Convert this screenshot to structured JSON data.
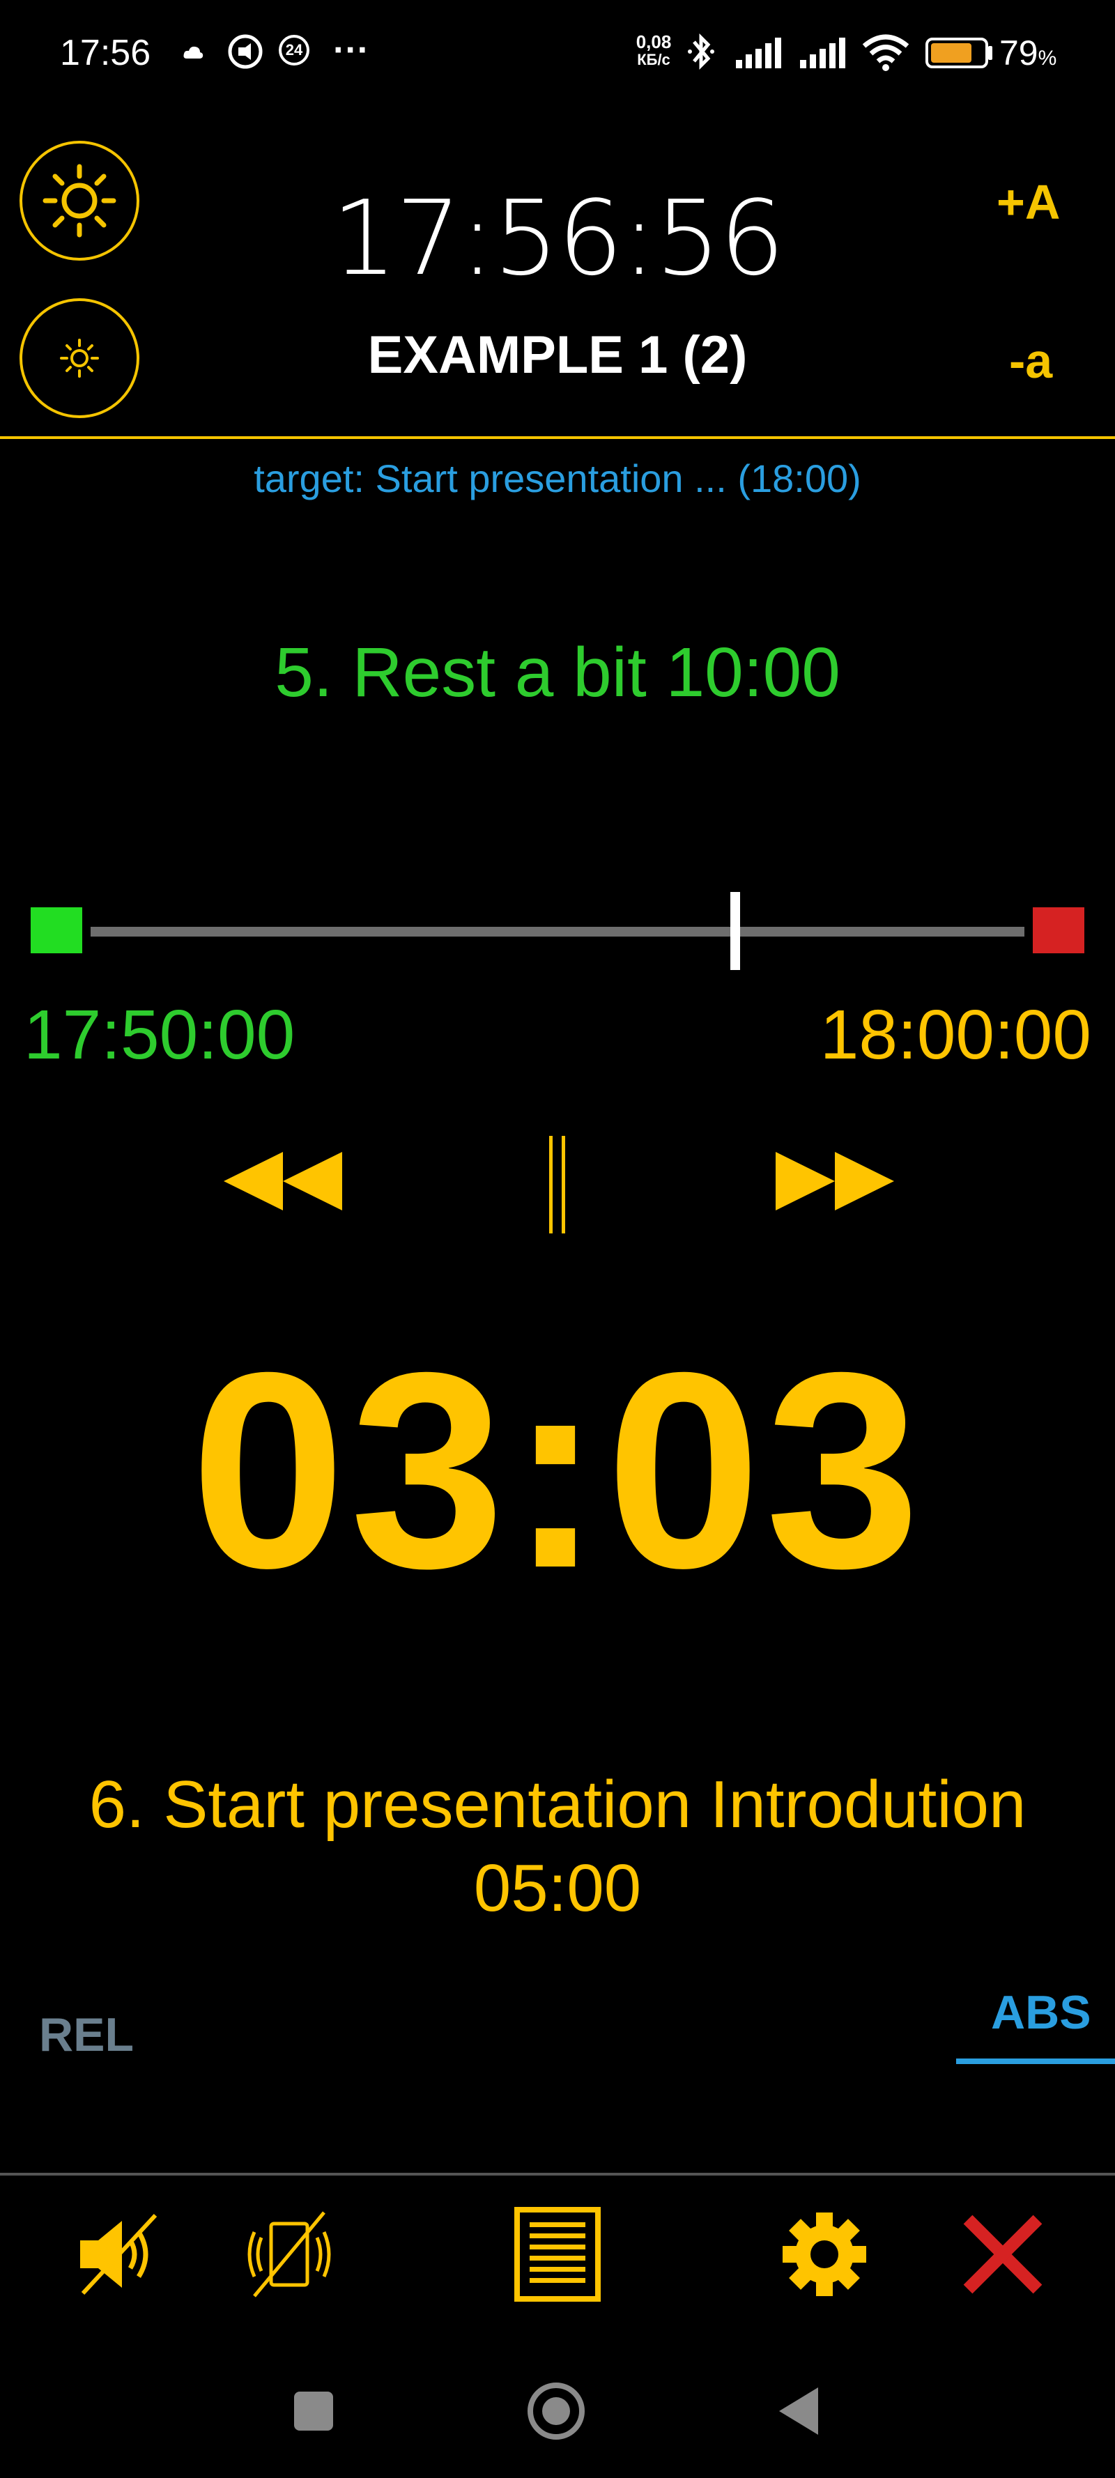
{
  "status_bar": {
    "time": "17:56",
    "notification_badge": "24",
    "more": "···",
    "net_speed_top": "0,08",
    "net_speed_bottom": "КБ/с",
    "battery": "79",
    "battery_unit": "%",
    "icons": [
      "cloud-icon",
      "whatsapp-icon",
      "badge-24-icon",
      "more-icon",
      "bluetooth-icon",
      "signal-icon",
      "signal-icon",
      "wifi-icon",
      "battery-icon"
    ]
  },
  "header": {
    "clock": "17:56:56",
    "title": "EXAMPLE 1 (2)",
    "font_increase": "+A",
    "font_decrease": "-a",
    "brightness_up_icon": "sun-large-icon",
    "brightness_down_icon": "sun-small-icon"
  },
  "target": "target: Start presentation ... (18:00)",
  "current_item": "5. Rest a bit 10:00",
  "progress": {
    "start_time": "17:50:00",
    "end_time": "18:00:00",
    "fraction": 0.69
  },
  "controls": {
    "rewind_icon": "rewind-icon",
    "pause_icon": "pause-icon",
    "forward_icon": "fast-forward-icon"
  },
  "countdown": "03:03",
  "next_item": "6. Start presentation Introdution 05:00",
  "tabs": {
    "rel": "REL",
    "abs": "ABS",
    "active": "ABS"
  },
  "toolbar": {
    "icons": [
      "speaker-muted-icon",
      "vibration-off-icon",
      "list-icon",
      "settings-gear-icon",
      "close-icon"
    ]
  },
  "navbar": {
    "icons": [
      "recents-square-icon",
      "home-circle-icon",
      "back-triangle-icon"
    ]
  },
  "colors": {
    "accent_yellow": "#ffc400",
    "green": "#2ecc2e",
    "blue": "#2a9ee0",
    "red": "#d62222",
    "background": "#000000"
  }
}
